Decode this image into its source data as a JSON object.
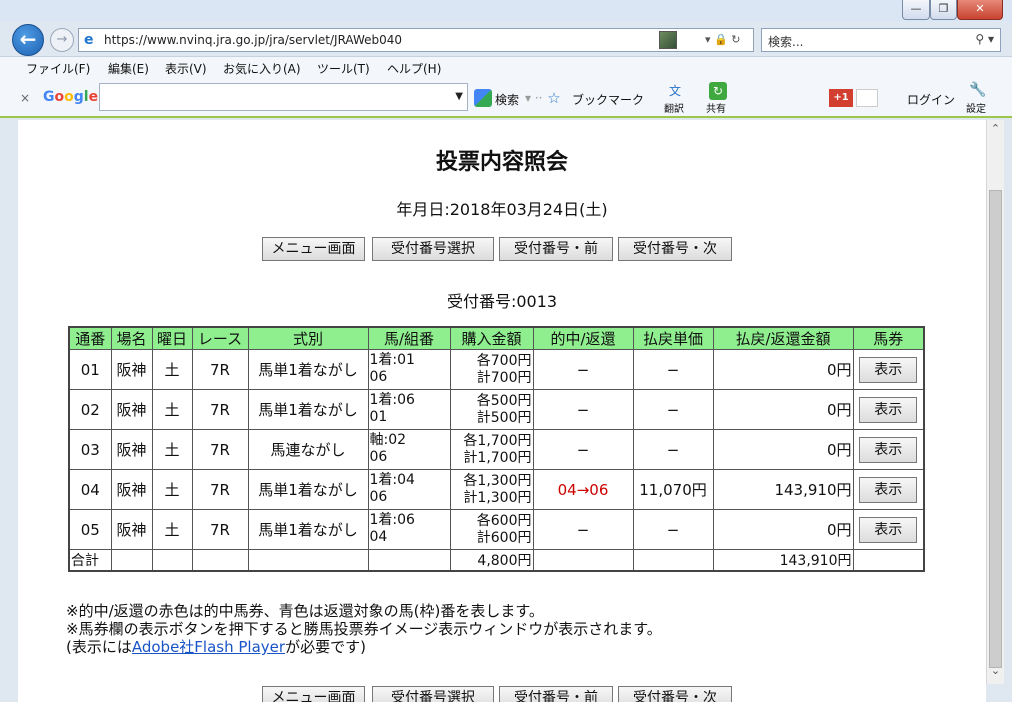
{
  "window": {
    "min": "—",
    "max": "❐",
    "close": "✕"
  },
  "address": {
    "url": "https://www.nvinq.jra.go.jp/jra/servlet/JRAWeb040",
    "controls": "▾ 🔒 ↻",
    "search_placeholder": "検索...",
    "search_icon": "⚲ ▾"
  },
  "menu": [
    "ファイル(F)",
    "編集(E)",
    "表示(V)",
    "お気に入り(A)",
    "ツール(T)",
    "ヘルプ(H)"
  ],
  "google": {
    "close": "×",
    "logo": "Google",
    "search_label": "検索",
    "bookmark_label": "ブックマーク",
    "translate_label": "翻訳",
    "share_label": "共有",
    "gplus_label": "+1",
    "login_label": "ログイン",
    "settings_label": "設定"
  },
  "page": {
    "title": "投票内容照会",
    "date_line": "年月日:2018年03月24日(土)",
    "buttons": [
      "メニュー画面",
      "受付番号選択",
      "受付番号・前",
      "受付番号・次"
    ],
    "receipt_line": "受付番号:0013",
    "headers": [
      "通番",
      "場名",
      "曜日",
      "レース",
      "式別",
      "馬/組番",
      "購入金額",
      "的中/返還",
      "払戻単価",
      "払戻/返還金額",
      "馬券"
    ],
    "rows": [
      {
        "no": "01",
        "venue": "阪神",
        "day": "土",
        "race": "7R",
        "type": "馬単1着ながし",
        "combo1": "1着:01",
        "combo2": "06",
        "each": "各700円",
        "total": "計700円",
        "hit": "−",
        "unit": "−",
        "payout": "0円",
        "ticket": "表示"
      },
      {
        "no": "02",
        "venue": "阪神",
        "day": "土",
        "race": "7R",
        "type": "馬単1着ながし",
        "combo1": "1着:06",
        "combo2": "01",
        "each": "各500円",
        "total": "計500円",
        "hit": "−",
        "unit": "−",
        "payout": "0円",
        "ticket": "表示"
      },
      {
        "no": "03",
        "venue": "阪神",
        "day": "土",
        "race": "7R",
        "type": "馬連ながし",
        "combo1": "軸:02",
        "combo2": "06",
        "each": "各1,700円",
        "total": "計1,700円",
        "hit": "−",
        "unit": "−",
        "payout": "0円",
        "ticket": "表示"
      },
      {
        "no": "04",
        "venue": "阪神",
        "day": "土",
        "race": "7R",
        "type": "馬単1着ながし",
        "combo1": "1着:04",
        "combo2": "06",
        "each": "各1,300円",
        "total": "計1,300円",
        "hit": "04→06",
        "unit": "11,070円",
        "payout": "143,910円",
        "ticket": "表示"
      },
      {
        "no": "05",
        "venue": "阪神",
        "day": "土",
        "race": "7R",
        "type": "馬単1着ながし",
        "combo1": "1着:06",
        "combo2": "04",
        "each": "各600円",
        "total": "計600円",
        "hit": "−",
        "unit": "−",
        "payout": "0円",
        "ticket": "表示"
      }
    ],
    "sum_label": "合計",
    "sum_purchase": "4,800円",
    "sum_payout": "143,910円",
    "notes": [
      "※的中/返還の赤色は的中馬券、青色は返還対象の馬(枠)番を表します。",
      "※馬券欄の表示ボタンを押下すると勝馬投票券イメージ表示ウィンドウが表示されます。"
    ],
    "note3_prefix": "(表示には",
    "note3_link": "Adobe社Flash Player",
    "note3_suffix": "が必要です)"
  },
  "colors": {
    "header_green": "#8fef8f",
    "hit_red": "#cc0000",
    "link_blue": "#1a55c7",
    "google_line": "#9bc84a"
  }
}
